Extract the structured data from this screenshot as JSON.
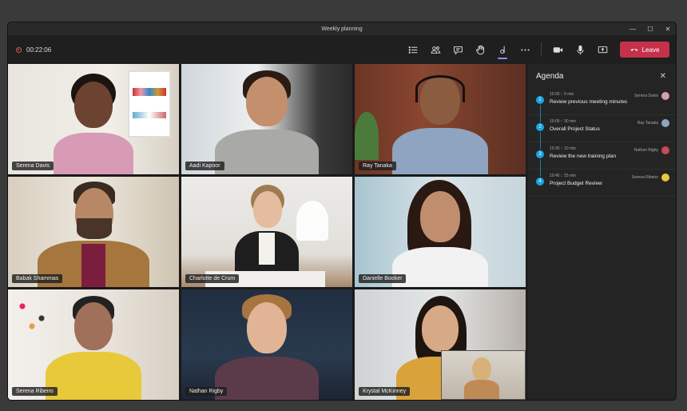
{
  "window": {
    "title": "Weekly planning"
  },
  "toolbar": {
    "timer": "00:22:06",
    "leave_label": "Leave",
    "icons": [
      "list-icon",
      "people-icon",
      "chat-icon",
      "raise-hand-icon",
      "apps-icon",
      "more-icon",
      "camera-icon",
      "mic-icon",
      "share-icon",
      "phone-icon"
    ]
  },
  "participants": [
    {
      "name": "Serena Davis"
    },
    {
      "name": "Aadi Kapoor"
    },
    {
      "name": "Ray Tanaka"
    },
    {
      "name": "Babak Shammas"
    },
    {
      "name": "Charlotte de Crum"
    },
    {
      "name": "Danielle Booker"
    },
    {
      "name": "Serena Ribeiro"
    },
    {
      "name": "Nathan Rigby"
    },
    {
      "name": "Krystal McKinney"
    }
  ],
  "agenda": {
    "title": "Agenda",
    "items": [
      {
        "number": "1",
        "time": "10:00 :: 5 min",
        "label": "Review previous meeting minutes",
        "owner": "Serena Davis"
      },
      {
        "number": "2",
        "time": "10:05 :: 30 min",
        "label": "Overall Project Status",
        "owner": "Ray Tanaka"
      },
      {
        "number": "3",
        "time": "10:35 :: 10 min",
        "label": "Review the new training plan",
        "owner": "Nathan Rigby"
      },
      {
        "number": "4",
        "time": "10:45 :: 15 min",
        "label": "Project Budget Review",
        "owner": "Serena Ribeiro"
      }
    ]
  },
  "colors": {
    "leave": "#c4314b",
    "accent": "#1aa4e0",
    "active_tab": "#8b8fe8"
  }
}
